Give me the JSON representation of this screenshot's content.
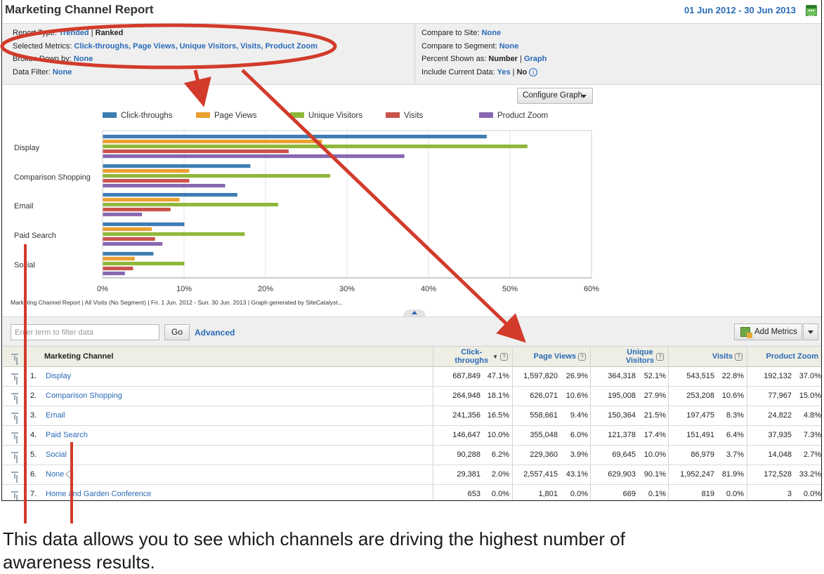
{
  "header": {
    "title": "Marketing Channel Report",
    "date_range": "01 Jun 2012 - 30 Jun 2013"
  },
  "settings": {
    "report_type": {
      "label": "Report Type:",
      "value": "Trended",
      "sep": " | ",
      "alt": "Ranked"
    },
    "selected_metrics": {
      "label": "Selected Metrics:",
      "value": "Click-throughs, Page Views, Unique Visitors, Visits, Product Zoom"
    },
    "broken_down_by": {
      "label": "Broken Down by:",
      "value": "None"
    },
    "data_filter": {
      "label": "Data Filter:",
      "value": "None"
    },
    "compare_to_site": {
      "label": "Compare to Site:",
      "value": "None"
    },
    "compare_to_segment": {
      "label": "Compare to Segment:",
      "value": "None"
    },
    "percent_shown_as": {
      "label": "Percent Shown as:",
      "value": "Number",
      "sep": " | ",
      "alt": "Graph"
    },
    "include_current_data": {
      "label": "Include Current Data:",
      "value": "Yes",
      "sep": " | ",
      "alt": "No"
    }
  },
  "chart": {
    "configure_label": "Configure Graph",
    "footer": "Marketing Channel Report | All Visits (No Segment) | Fri.  1 Jun. 2012 - Sun. 30 Jun. 2013 | Graph generated by SiteCatalyst..."
  },
  "chart_data": {
    "type": "bar",
    "orientation": "horizontal",
    "categories": [
      "Display",
      "Comparison Shopping",
      "Email",
      "Paid Search",
      "Social"
    ],
    "series": [
      {
        "name": "Click-throughs",
        "color": "#3f7db3",
        "values": [
          47.1,
          18.1,
          16.5,
          10.0,
          6.2
        ]
      },
      {
        "name": "Page Views",
        "color": "#e9a030",
        "values": [
          26.9,
          10.6,
          9.4,
          6.0,
          3.9
        ]
      },
      {
        "name": "Unique Visitors",
        "color": "#8fb83b",
        "values": [
          52.1,
          27.9,
          21.5,
          17.4,
          10.0
        ]
      },
      {
        "name": "Visits",
        "color": "#c9534b",
        "values": [
          22.8,
          10.6,
          8.3,
          6.4,
          3.7
        ]
      },
      {
        "name": "Product Zoom",
        "color": "#8a67b1",
        "values": [
          37.0,
          15.0,
          4.8,
          7.3,
          2.7
        ]
      }
    ],
    "xlim": [
      0,
      60
    ],
    "xticks": [
      "0%",
      "10%",
      "20%",
      "30%",
      "40%",
      "50%",
      "60%"
    ],
    "grid": true,
    "legend_position": "top"
  },
  "filter": {
    "placeholder": "Enter term to filter data",
    "go_label": "Go",
    "advanced_label": "Advanced",
    "add_metrics_label": "Add Metrics"
  },
  "table": {
    "headers": {
      "channel": "Marketing Channel",
      "click_throughs": "Click-\nthroughs",
      "page_views": "Page Views",
      "unique_visitors": "Unique\nVisitors",
      "visits": "Visits",
      "product_zoom": "Product Zoom"
    },
    "rows": [
      {
        "num": "1.",
        "name": "Display",
        "ct": "687,849",
        "ctp": "47.1%",
        "pv": "1,597,820",
        "pvp": "26.9%",
        "uv": "364,318",
        "uvp": "52.1%",
        "v": "543,515",
        "vp": "22.8%",
        "pz": "192,132",
        "pzp": "37.0%"
      },
      {
        "num": "2.",
        "name": "Comparison Shopping",
        "ct": "264,948",
        "ctp": "18.1%",
        "pv": "626,071",
        "pvp": "10.6%",
        "uv": "195,008",
        "uvp": "27.9%",
        "v": "253,208",
        "vp": "10.6%",
        "pz": "77,967",
        "pzp": "15.0%"
      },
      {
        "num": "3.",
        "name": "Email",
        "ct": "241,356",
        "ctp": "16.5%",
        "pv": "558,661",
        "pvp": "9.4%",
        "uv": "150,364",
        "uvp": "21.5%",
        "v": "197,475",
        "vp": "8.3%",
        "pz": "24,822",
        "pzp": "4.8%"
      },
      {
        "num": "4.",
        "name": "Paid Search",
        "ct": "146,647",
        "ctp": "10.0%",
        "pv": "355,048",
        "pvp": "6.0%",
        "uv": "121,378",
        "uvp": "17.4%",
        "v": "151,491",
        "vp": "6.4%",
        "pz": "37,935",
        "pzp": "7.3%"
      },
      {
        "num": "5.",
        "name": "Social",
        "ct": "90,288",
        "ctp": "6.2%",
        "pv": "229,360",
        "pvp": "3.9%",
        "uv": "69,645",
        "uvp": "10.0%",
        "v": "86,979",
        "vp": "3.7%",
        "pz": "14,048",
        "pzp": "2.7%"
      },
      {
        "num": "6.",
        "name": "None",
        "ct": "29,381",
        "ctp": "2.0%",
        "pv": "2,557,415",
        "pvp": "43.1%",
        "uv": "629,903",
        "uvp": "90.1%",
        "v": "1,952,247",
        "vp": "81.9%",
        "pz": "172,528",
        "pzp": "33.2%"
      },
      {
        "num": "7.",
        "name": "Home and Garden Conference",
        "ct": "653",
        "ctp": "0.0%",
        "pv": "1,801",
        "pvp": "0.0%",
        "uv": "669",
        "uvp": "0.1%",
        "v": "819",
        "vp": "0.0%",
        "pz": "3",
        "pzp": "0.0%"
      }
    ]
  },
  "annotation": {
    "caption": "This data allows you to see which channels are driving the highest number of awareness results.",
    "color": "#d23b2b"
  }
}
